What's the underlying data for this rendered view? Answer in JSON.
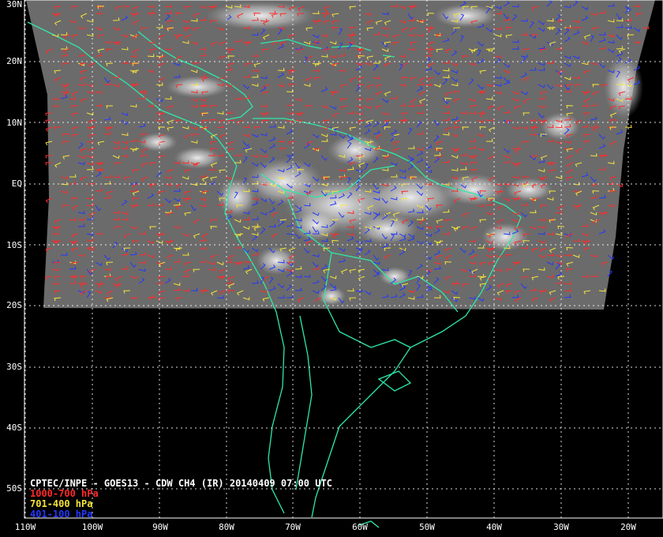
{
  "map": {
    "title": "CPTEC/INPE - GOES13 - CDW CH4 (IR) 20140409 07:00 UTC",
    "legend": [
      {
        "label": "1000-700 hPa",
        "color": "#ff2a2a"
      },
      {
        "label": "701-400 hPa",
        "color": "#f4e43a"
      },
      {
        "label": "401-100 hPa",
        "color": "#2438ff"
      }
    ],
    "latitude_labels": [
      "30N",
      "20N",
      "10N",
      "EQ",
      "10S",
      "20S",
      "30S",
      "40S",
      "50S"
    ],
    "longitude_labels": [
      "110W",
      "100W",
      "90W",
      "80W",
      "70W",
      "60W",
      "50W",
      "40W",
      "30W",
      "20W"
    ],
    "colors": {
      "background": "#000000",
      "coastline": "#2ee8a8",
      "grid": "#ffffff",
      "imagery": "#6a6a6a"
    }
  }
}
